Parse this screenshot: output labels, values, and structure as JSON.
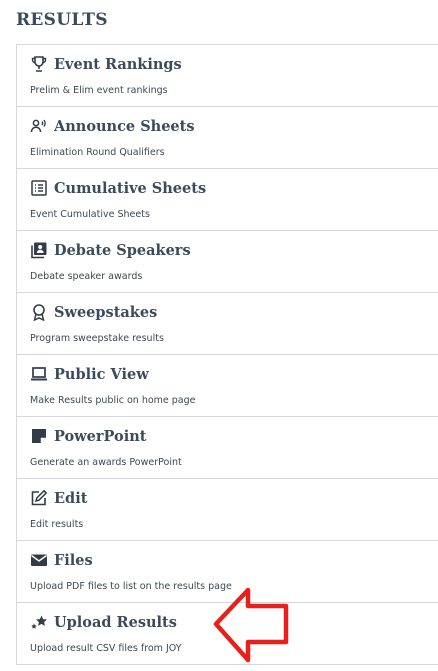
{
  "section": {
    "title": "RESULTS"
  },
  "items": [
    {
      "icon": "trophy-icon",
      "title": "Event Rankings",
      "desc": "Prelim & Elim event rankings"
    },
    {
      "icon": "announce-icon",
      "title": "Announce Sheets",
      "desc": "Elimination Round Qualifiers"
    },
    {
      "icon": "list-icon",
      "title": "Cumulative Sheets",
      "desc": "Event Cumulative Sheets"
    },
    {
      "icon": "speaker-icon",
      "title": "Debate Speakers",
      "desc": "Debate speaker awards"
    },
    {
      "icon": "ribbon-icon",
      "title": "Sweepstakes",
      "desc": "Program sweepstake results"
    },
    {
      "icon": "laptop-icon",
      "title": "Public View",
      "desc": "Make Results public on home page"
    },
    {
      "icon": "note-icon",
      "title": "PowerPoint",
      "desc": "Generate an awards PowerPoint"
    },
    {
      "icon": "edit-icon",
      "title": "Edit",
      "desc": "Edit results"
    },
    {
      "icon": "envelope-icon",
      "title": "Files",
      "desc": "Upload PDF files to list on the results page"
    },
    {
      "icon": "stars-icon",
      "title": "Upload Results",
      "desc": "Upload result CSV files from JOY"
    }
  ],
  "annotation": {
    "color": "#e8201c"
  }
}
